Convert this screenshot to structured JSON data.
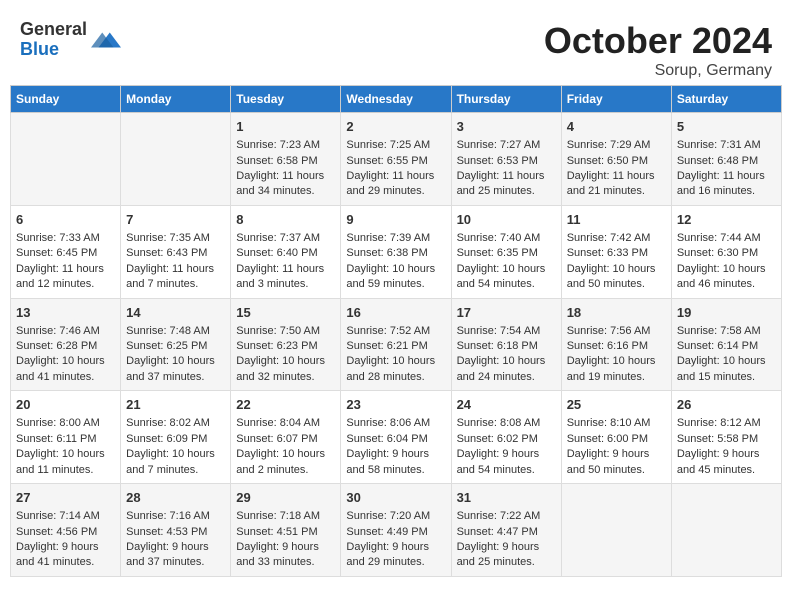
{
  "header": {
    "logo_general": "General",
    "logo_blue": "Blue",
    "title": "October 2024",
    "subtitle": "Sorup, Germany"
  },
  "columns": [
    "Sunday",
    "Monday",
    "Tuesday",
    "Wednesday",
    "Thursday",
    "Friday",
    "Saturday"
  ],
  "rows": [
    [
      {
        "day": "",
        "info": ""
      },
      {
        "day": "",
        "info": ""
      },
      {
        "day": "1",
        "info": "Sunrise: 7:23 AM\nSunset: 6:58 PM\nDaylight: 11 hours\nand 34 minutes."
      },
      {
        "day": "2",
        "info": "Sunrise: 7:25 AM\nSunset: 6:55 PM\nDaylight: 11 hours\nand 29 minutes."
      },
      {
        "day": "3",
        "info": "Sunrise: 7:27 AM\nSunset: 6:53 PM\nDaylight: 11 hours\nand 25 minutes."
      },
      {
        "day": "4",
        "info": "Sunrise: 7:29 AM\nSunset: 6:50 PM\nDaylight: 11 hours\nand 21 minutes."
      },
      {
        "day": "5",
        "info": "Sunrise: 7:31 AM\nSunset: 6:48 PM\nDaylight: 11 hours\nand 16 minutes."
      }
    ],
    [
      {
        "day": "6",
        "info": "Sunrise: 7:33 AM\nSunset: 6:45 PM\nDaylight: 11 hours\nand 12 minutes."
      },
      {
        "day": "7",
        "info": "Sunrise: 7:35 AM\nSunset: 6:43 PM\nDaylight: 11 hours\nand 7 minutes."
      },
      {
        "day": "8",
        "info": "Sunrise: 7:37 AM\nSunset: 6:40 PM\nDaylight: 11 hours\nand 3 minutes."
      },
      {
        "day": "9",
        "info": "Sunrise: 7:39 AM\nSunset: 6:38 PM\nDaylight: 10 hours\nand 59 minutes."
      },
      {
        "day": "10",
        "info": "Sunrise: 7:40 AM\nSunset: 6:35 PM\nDaylight: 10 hours\nand 54 minutes."
      },
      {
        "day": "11",
        "info": "Sunrise: 7:42 AM\nSunset: 6:33 PM\nDaylight: 10 hours\nand 50 minutes."
      },
      {
        "day": "12",
        "info": "Sunrise: 7:44 AM\nSunset: 6:30 PM\nDaylight: 10 hours\nand 46 minutes."
      }
    ],
    [
      {
        "day": "13",
        "info": "Sunrise: 7:46 AM\nSunset: 6:28 PM\nDaylight: 10 hours\nand 41 minutes."
      },
      {
        "day": "14",
        "info": "Sunrise: 7:48 AM\nSunset: 6:25 PM\nDaylight: 10 hours\nand 37 minutes."
      },
      {
        "day": "15",
        "info": "Sunrise: 7:50 AM\nSunset: 6:23 PM\nDaylight: 10 hours\nand 32 minutes."
      },
      {
        "day": "16",
        "info": "Sunrise: 7:52 AM\nSunset: 6:21 PM\nDaylight: 10 hours\nand 28 minutes."
      },
      {
        "day": "17",
        "info": "Sunrise: 7:54 AM\nSunset: 6:18 PM\nDaylight: 10 hours\nand 24 minutes."
      },
      {
        "day": "18",
        "info": "Sunrise: 7:56 AM\nSunset: 6:16 PM\nDaylight: 10 hours\nand 19 minutes."
      },
      {
        "day": "19",
        "info": "Sunrise: 7:58 AM\nSunset: 6:14 PM\nDaylight: 10 hours\nand 15 minutes."
      }
    ],
    [
      {
        "day": "20",
        "info": "Sunrise: 8:00 AM\nSunset: 6:11 PM\nDaylight: 10 hours\nand 11 minutes."
      },
      {
        "day": "21",
        "info": "Sunrise: 8:02 AM\nSunset: 6:09 PM\nDaylight: 10 hours\nand 7 minutes."
      },
      {
        "day": "22",
        "info": "Sunrise: 8:04 AM\nSunset: 6:07 PM\nDaylight: 10 hours\nand 2 minutes."
      },
      {
        "day": "23",
        "info": "Sunrise: 8:06 AM\nSunset: 6:04 PM\nDaylight: 9 hours\nand 58 minutes."
      },
      {
        "day": "24",
        "info": "Sunrise: 8:08 AM\nSunset: 6:02 PM\nDaylight: 9 hours\nand 54 minutes."
      },
      {
        "day": "25",
        "info": "Sunrise: 8:10 AM\nSunset: 6:00 PM\nDaylight: 9 hours\nand 50 minutes."
      },
      {
        "day": "26",
        "info": "Sunrise: 8:12 AM\nSunset: 5:58 PM\nDaylight: 9 hours\nand 45 minutes."
      }
    ],
    [
      {
        "day": "27",
        "info": "Sunrise: 7:14 AM\nSunset: 4:56 PM\nDaylight: 9 hours\nand 41 minutes."
      },
      {
        "day": "28",
        "info": "Sunrise: 7:16 AM\nSunset: 4:53 PM\nDaylight: 9 hours\nand 37 minutes."
      },
      {
        "day": "29",
        "info": "Sunrise: 7:18 AM\nSunset: 4:51 PM\nDaylight: 9 hours\nand 33 minutes."
      },
      {
        "day": "30",
        "info": "Sunrise: 7:20 AM\nSunset: 4:49 PM\nDaylight: 9 hours\nand 29 minutes."
      },
      {
        "day": "31",
        "info": "Sunrise: 7:22 AM\nSunset: 4:47 PM\nDaylight: 9 hours\nand 25 minutes."
      },
      {
        "day": "",
        "info": ""
      },
      {
        "day": "",
        "info": ""
      }
    ]
  ]
}
